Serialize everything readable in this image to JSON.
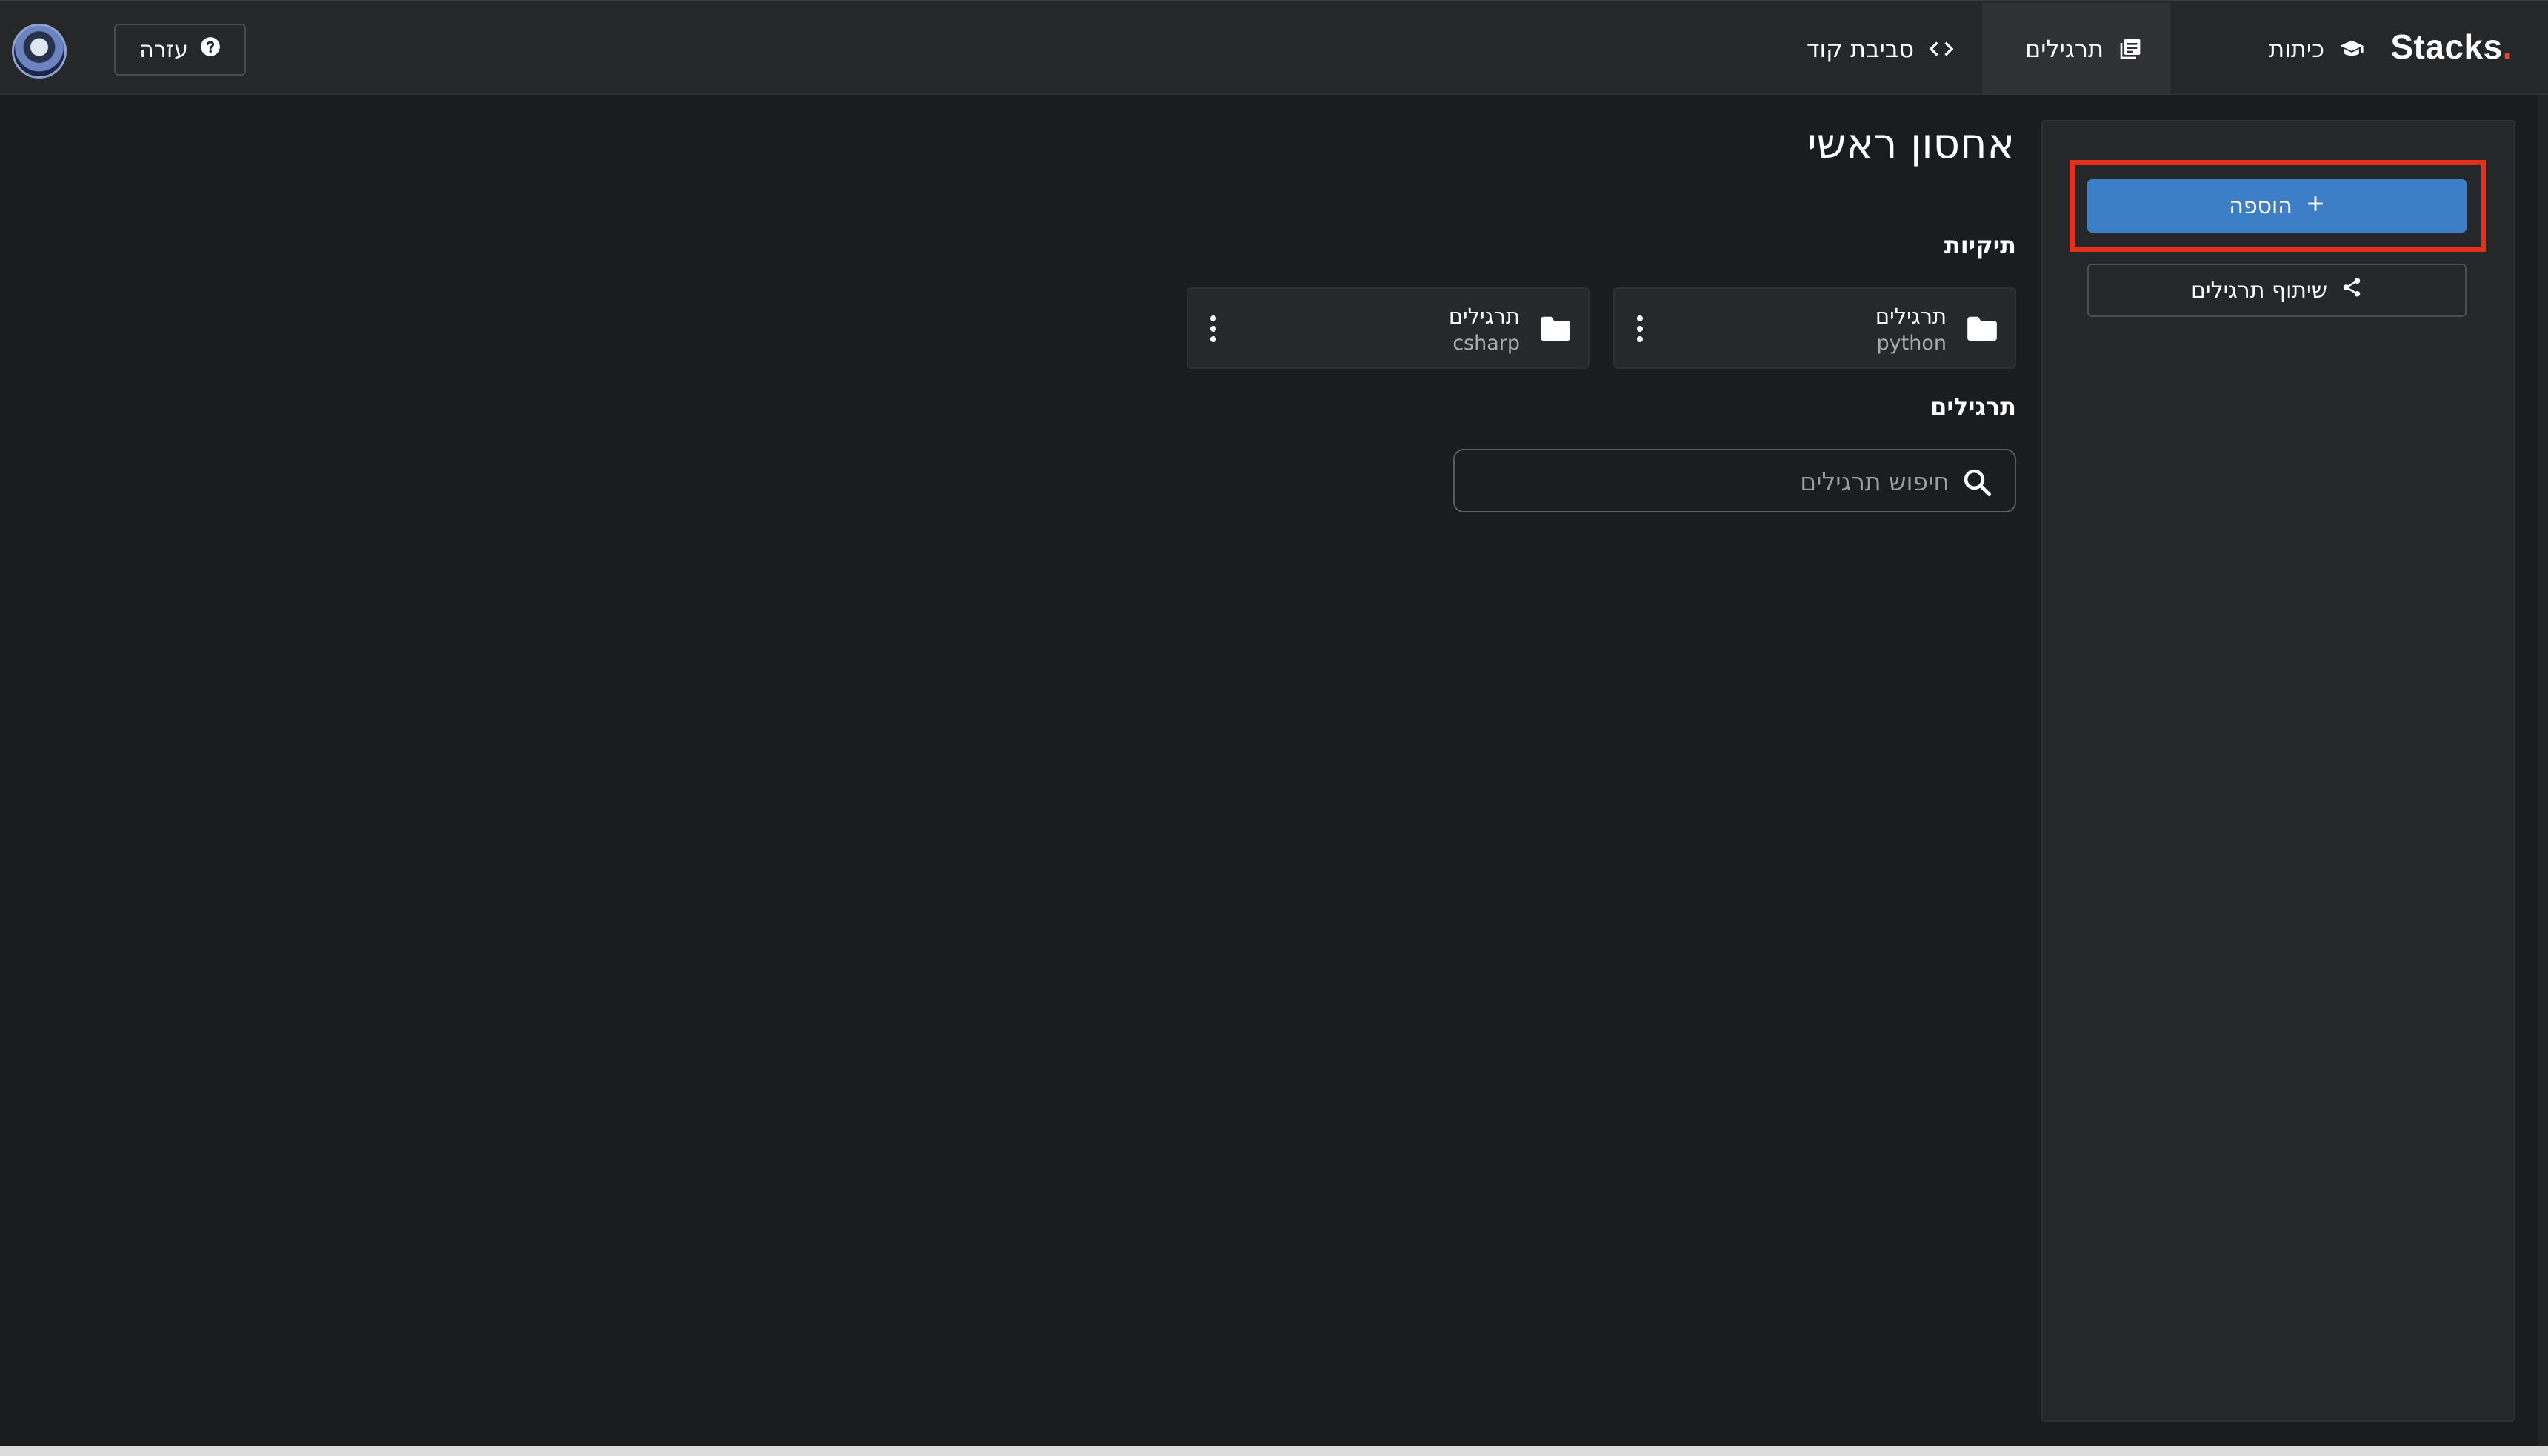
{
  "header": {
    "brand": {
      "name": "Stacks",
      "dot": "."
    },
    "nav": [
      {
        "label": "כיתות",
        "icon": "graduation-cap-icon",
        "active": false
      },
      {
        "label": "תרגילים",
        "icon": "book-icon",
        "active": true
      },
      {
        "label": "סביבת קוד",
        "icon": "code-icon",
        "active": false
      }
    ],
    "help": {
      "label": "עזרה",
      "icon": "question-circle-icon"
    },
    "avatar": {
      "icon": "user-avatar"
    }
  },
  "sidebar": {
    "add_button": {
      "label": "הוספה",
      "icon": "plus-icon"
    },
    "share_button": {
      "label": "שיתוף תרגילים",
      "icon": "share-icon"
    }
  },
  "main": {
    "title": "אחסון ראשי",
    "folders_heading": "תיקיות",
    "folders": [
      {
        "name": "תרגילים",
        "language": "python",
        "icon": "folder-icon"
      },
      {
        "name": "תרגילים",
        "language": "csharp",
        "icon": "folder-icon"
      }
    ],
    "exercises_heading": "תרגילים",
    "search": {
      "placeholder": "חיפוש תרגילים",
      "value": "",
      "icon": "search-icon"
    }
  },
  "colors": {
    "background": "#1b1c1e",
    "topbar": "#262729",
    "accent": "#3c7fc6",
    "highlight": "#e0311f",
    "brand_dot": "#e04a3a"
  }
}
